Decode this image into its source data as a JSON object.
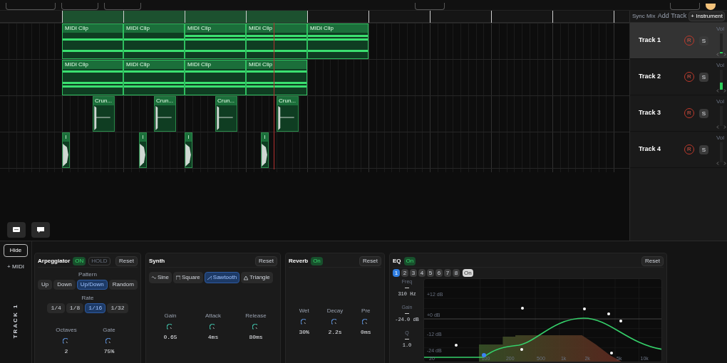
{
  "timeline": {
    "tracks": [
      {
        "clips": [
          {
            "kind": "midi",
            "label": "MIDI Clip"
          },
          {
            "kind": "midi",
            "label": "MIDI Clip"
          },
          {
            "kind": "midi",
            "label": "MIDI Clip"
          },
          {
            "kind": "midi",
            "label": "MIDI Clip"
          },
          {
            "kind": "midi",
            "label": "MIDI Clip"
          }
        ]
      },
      {
        "clips": [
          {
            "kind": "midi",
            "label": "MIDI Clip"
          },
          {
            "kind": "midi",
            "label": "MIDI Clip"
          },
          {
            "kind": "midi",
            "label": "MIDI Clip"
          },
          {
            "kind": "midi",
            "label": "MIDI Clip"
          }
        ]
      },
      {
        "clips": [
          {
            "kind": "audio",
            "label": "Crun..."
          },
          {
            "kind": "audio",
            "label": "Crun..."
          },
          {
            "kind": "audio",
            "label": "Crun..."
          },
          {
            "kind": "audio",
            "label": "Crun..."
          }
        ]
      },
      {
        "clips": [
          {
            "kind": "hit",
            "label": "I"
          },
          {
            "kind": "hit",
            "label": "I"
          },
          {
            "kind": "hit",
            "label": "I"
          },
          {
            "kind": "hit",
            "label": "I"
          }
        ]
      }
    ]
  },
  "mixer": {
    "sync_label": "Sync Mix",
    "add_label": "Add Track",
    "add_button": "+ Instrument",
    "tracks": [
      {
        "name": "Track 1",
        "selected": true,
        "vol_label": "Vol",
        "record": "R",
        "solo": "S",
        "level": 0.08
      },
      {
        "name": "Track 2",
        "selected": false,
        "vol_label": "Vol",
        "record": "R",
        "solo": "S",
        "level": 0.35
      },
      {
        "name": "Track 3",
        "selected": false,
        "vol_label": "Vol",
        "record": "R",
        "solo": "S",
        "level": 0
      },
      {
        "name": "Track 4",
        "selected": false,
        "vol_label": "Vol",
        "record": "R",
        "solo": "S",
        "level": 0
      }
    ]
  },
  "device": {
    "hide_button": "Hide",
    "add_midi": "+ MIDI",
    "track_label": "TRACK 1"
  },
  "arpeggiator": {
    "title": "Arpeggiator",
    "on": {
      "label": "ON",
      "active": true
    },
    "hold": {
      "label": "HOLD",
      "active": false
    },
    "reset": "Reset",
    "pattern_label": "Pattern",
    "patterns": [
      {
        "label": "Up",
        "selected": false
      },
      {
        "label": "Down",
        "selected": false
      },
      {
        "label": "Up/Down",
        "selected": true
      },
      {
        "label": "Random",
        "selected": false
      }
    ],
    "rate_label": "Rate",
    "rates": [
      {
        "label": "1/4",
        "selected": false
      },
      {
        "label": "1/8",
        "selected": false
      },
      {
        "label": "1/16",
        "selected": true
      },
      {
        "label": "1/32",
        "selected": false
      }
    ],
    "knobs": [
      {
        "label": "Octaves",
        "value": "2"
      },
      {
        "label": "Gate",
        "value": "75%"
      }
    ]
  },
  "synth": {
    "title": "Synth",
    "reset": "Reset",
    "waveforms": [
      {
        "kind": "sine",
        "label": "Sine",
        "selected": false
      },
      {
        "kind": "square",
        "label": "Square",
        "selected": false
      },
      {
        "kind": "sawtooth",
        "label": "Sawtooth",
        "selected": true
      },
      {
        "kind": "triangle",
        "label": "Triangle",
        "selected": false
      }
    ],
    "knobs": [
      {
        "label": "Gain",
        "value": "0.65"
      },
      {
        "label": "Attack",
        "value": "4ms"
      },
      {
        "label": "Release",
        "value": "80ms"
      }
    ]
  },
  "reverb": {
    "title": "Reverb",
    "on": {
      "label": "On",
      "active": true
    },
    "reset": "Reset",
    "knobs": [
      {
        "label": "Wet",
        "value": "30%"
      },
      {
        "label": "Decay",
        "value": "2.2s"
      },
      {
        "label": "Pre",
        "value": "0ms"
      }
    ]
  },
  "eq": {
    "title": "EQ",
    "on": {
      "label": "On",
      "active": true
    },
    "reset": "Reset",
    "bands": [
      {
        "label": "1",
        "selected": true
      },
      {
        "label": "2",
        "selected": false
      },
      {
        "label": "3",
        "selected": false
      },
      {
        "label": "4",
        "selected": false
      },
      {
        "label": "5",
        "selected": false
      },
      {
        "label": "6",
        "selected": false
      },
      {
        "label": "7",
        "selected": false
      },
      {
        "label": "8",
        "selected": false
      }
    ],
    "band_toggle": "On",
    "params": [
      {
        "label": "Freq",
        "value": "310 Hz"
      },
      {
        "label": "Gain",
        "value": "-24.0 dB"
      },
      {
        "label": "Q",
        "value": "1.0"
      }
    ],
    "gain_labels": [
      "+12 dB",
      "+0 dB",
      "-12 dB",
      "-24 dB"
    ],
    "freq_labels": [
      "20",
      "100",
      "200",
      "500",
      "1k",
      "2k",
      "5k",
      "10k"
    ]
  }
}
